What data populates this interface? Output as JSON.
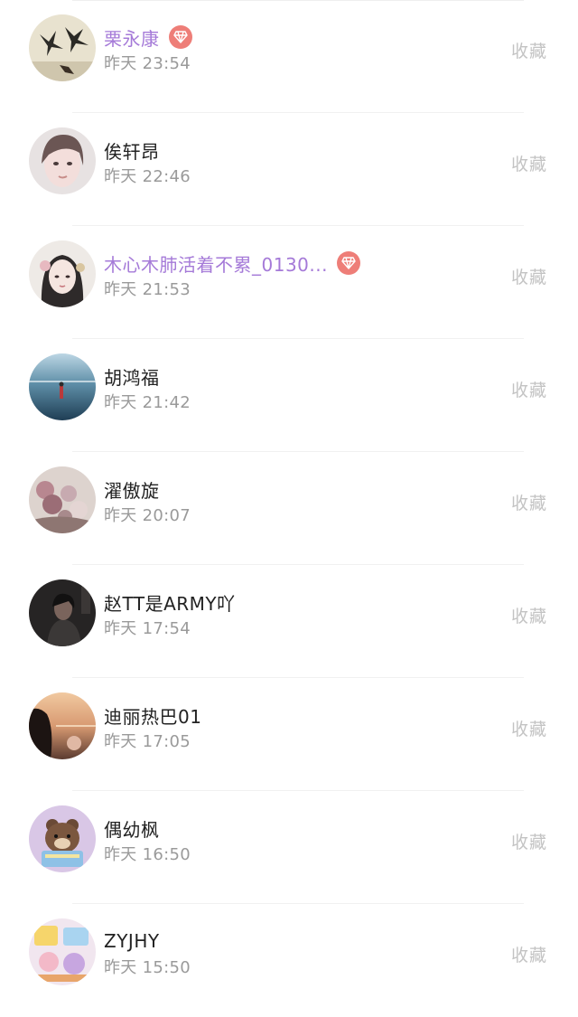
{
  "list": {
    "items": [
      {
        "name": "栗永康",
        "time": "昨天 23:54",
        "action": "收藏",
        "vip": true,
        "avatar": "swallow-birds-avatar"
      },
      {
        "name": "俟轩昂",
        "time": "昨天 22:46",
        "action": "收藏",
        "vip": false,
        "avatar": "girl-portrait-avatar"
      },
      {
        "name": "木心木肺活着不累_0130...",
        "time": "昨天 21:53",
        "action": "收藏",
        "vip": true,
        "avatar": "illustrated-girl-avatar"
      },
      {
        "name": "胡鸿福",
        "time": "昨天 21:42",
        "action": "收藏",
        "vip": false,
        "avatar": "sea-figure-avatar"
      },
      {
        "name": "濯傲旋",
        "time": "昨天 20:07",
        "action": "收藏",
        "vip": false,
        "avatar": "flowers-avatar"
      },
      {
        "name": "赵TT是ARMY吖",
        "time": "昨天 17:54",
        "action": "收藏",
        "vip": false,
        "avatar": "dark-person-avatar"
      },
      {
        "name": "迪丽热巴01",
        "time": "昨天 17:05",
        "action": "收藏",
        "vip": false,
        "avatar": "sunset-person-avatar"
      },
      {
        "name": "偶幼枫",
        "time": "昨天 16:50",
        "action": "收藏",
        "vip": false,
        "avatar": "cartoon-bear-avatar"
      },
      {
        "name": "ZYJHY",
        "time": "昨天 15:50",
        "action": "收藏",
        "vip": false,
        "avatar": "cartoon-collage-avatar"
      }
    ]
  },
  "colors": {
    "vip_name": "#a57ad8",
    "vip_badge": "#ee7e78",
    "name": "#222222",
    "time": "#9a9a9a",
    "action": "#c3c3c3"
  }
}
